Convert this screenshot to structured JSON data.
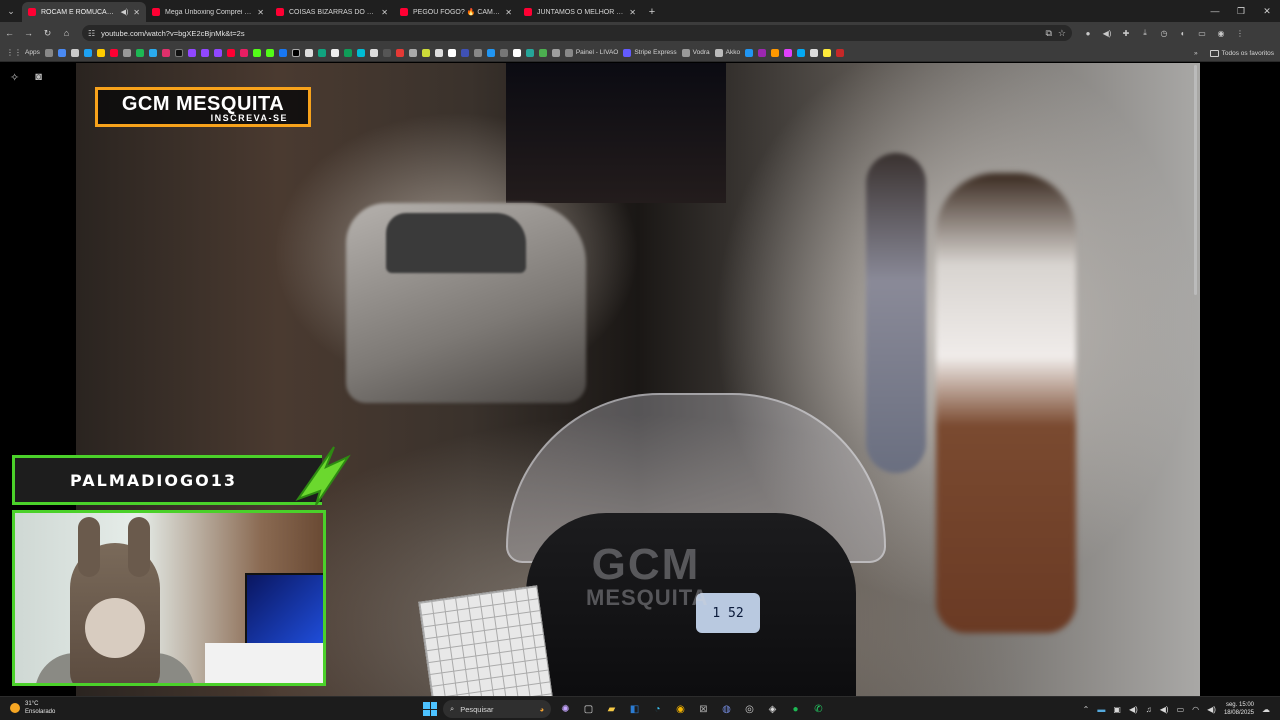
{
  "tabs": [
    {
      "title": "ROCAM E ROMUCAM JUNTAS",
      "active": true,
      "color": "#ff0033"
    },
    {
      "title": "Mega Unboxing Comprei Vario",
      "active": false,
      "color": "#ff0033"
    },
    {
      "title": "COISAS BIZARRAS DO SEVEN IN",
      "active": false,
      "color": "#ff0033"
    },
    {
      "title": "PEGOU FOGO? 🔥 CAMARIM",
      "active": false,
      "color": "#ff0033"
    },
    {
      "title": "JUNTAMOS O MELHOR DO BOI",
      "active": false,
      "color": "#ff0033"
    }
  ],
  "address": {
    "url": "youtube.com/watch?v=bgXE2cBjnMk&t=2s"
  },
  "bookmarks": {
    "apps_label": "Apps",
    "labeled": [
      {
        "label": "Painel - LIVAO",
        "color": "#888888"
      },
      {
        "label": "Stripe Express",
        "color": "#635bff"
      },
      {
        "label": "Vodra",
        "color": "#999999"
      },
      {
        "label": "Akko",
        "color": "#bbbbbb"
      }
    ],
    "others_label": "Todos os favoritos"
  },
  "video": {
    "logo_title": "GCM MESQUITA",
    "logo_subtitle": "INSCREVA-SE",
    "watermark_line1": "GCM",
    "watermark_line2": "MESQUITA",
    "speedo": "1 52"
  },
  "webcam": {
    "name": "PALMADIOGO13"
  },
  "taskbar": {
    "temp": "31°C",
    "weather": "Ensolarado",
    "search_placeholder": "Pesquisar",
    "time": "seg. 15:00",
    "date": "18/08/2025"
  }
}
